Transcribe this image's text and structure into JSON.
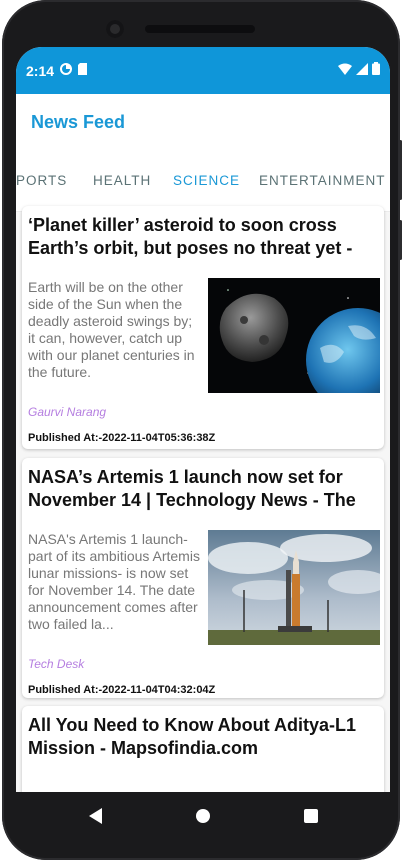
{
  "status_bar": {
    "time": "2:14"
  },
  "app_bar": {
    "title": "News Feed"
  },
  "tabs": [
    {
      "label": "SPORTS",
      "active": false
    },
    {
      "label": "HEALTH",
      "active": false
    },
    {
      "label": "SCIENCE",
      "active": true
    },
    {
      "label": "ENTERTAINMENT",
      "active": false
    }
  ],
  "articles": [
    {
      "title": "‘Planet killer’ asteroid to soon cross Earth’s orbit, but poses no threat yet -",
      "description": "Earth will be on the other side of the Sun when the deadly asteroid swings by; it can, however, catch up with our planet centuries in the future.",
      "image": "asteroid-and-earth",
      "author": "Gaurvi Narang",
      "published": "Published At:-2022-11-04T05:36:38Z"
    },
    {
      "title": "NASA’s Artemis 1 launch now set for November 14 | Technology News - The",
      "description": "NASA's Artemis 1 launch- part of its ambitious Artemis lunar missions- is now set for November 14. The date announcement comes after two failed la...",
      "image": "rocket-on-launch-pad",
      "author": "Tech Desk",
      "published": "Published At:-2022-11-04T04:32:04Z"
    },
    {
      "title": "All You Need to Know About Aditya-L1 Mission - Mapsofindia.com"
    }
  ],
  "colors": {
    "accent": "#1a98d6",
    "status_bar": "#0f96d9",
    "author": "#b57ee0"
  }
}
